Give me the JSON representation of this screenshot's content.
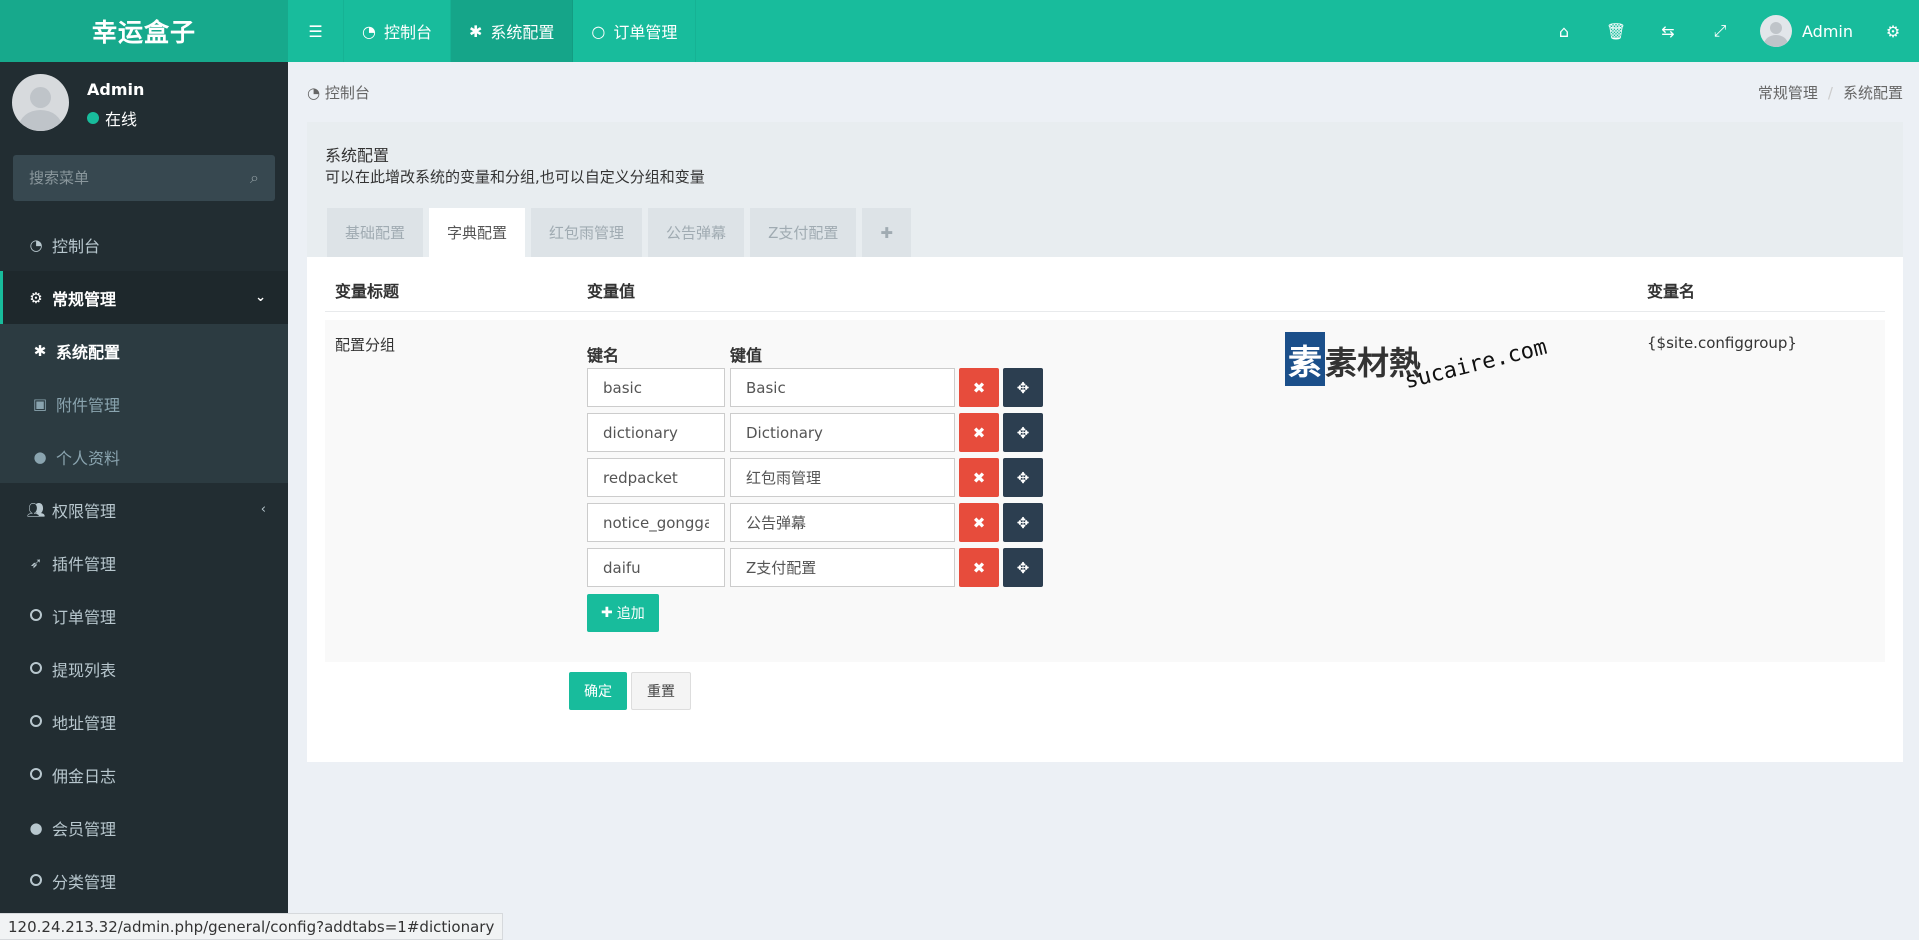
{
  "app": {
    "logo": "幸运盒子"
  },
  "topnav": {
    "toggle_icon": "menu-icon",
    "items": [
      {
        "label": "控制台",
        "icon": "dashboard-icon"
      },
      {
        "label": "系统配置",
        "icon": "gear-icon"
      },
      {
        "label": "订单管理",
        "icon": "circle-icon"
      }
    ],
    "right_icons": [
      "home-icon",
      "trash-icon",
      "translate-icon",
      "fullscreen-icon"
    ],
    "user": "Admin",
    "settings_icon": "cogs-icon"
  },
  "sidebar": {
    "user_name": "Admin",
    "status": "在线",
    "search_placeholder": "搜索菜单",
    "items": [
      {
        "label": "控制台"
      },
      {
        "label": "常规管理"
      },
      {
        "label": "系统配置"
      },
      {
        "label": "附件管理"
      },
      {
        "label": "个人资料"
      },
      {
        "label": "权限管理"
      },
      {
        "label": "插件管理"
      },
      {
        "label": "订单管理"
      },
      {
        "label": "提现列表"
      },
      {
        "label": "地址管理"
      },
      {
        "label": "佣金日志"
      },
      {
        "label": "会员管理"
      },
      {
        "label": "分类管理"
      }
    ]
  },
  "header": {
    "title": "控制台",
    "breadcrumbs": [
      "常规管理",
      "系统配置"
    ]
  },
  "panel": {
    "title": "系统配置",
    "description": "可以在此增改系统的变量和分组,也可以自定义分组和变量",
    "tabs": [
      "基础配置",
      "字典配置",
      "红包雨管理",
      "公告弹幕",
      "Z支付配置",
      "✚"
    ]
  },
  "table": {
    "headers": [
      "变量标题",
      "变量值",
      "变量名"
    ],
    "row_label": "配置分组",
    "key_header": "键名",
    "value_header": "键值",
    "var_name": "{$site.configgroup}",
    "rows": [
      {
        "key": "basic",
        "value": "Basic"
      },
      {
        "key": "dictionary",
        "value": "Dictionary"
      },
      {
        "key": "redpacket",
        "value": "红包雨管理"
      },
      {
        "key": "notice_gonggao",
        "value": "公告弹幕"
      },
      {
        "key": "daifu",
        "value": "Z支付配置"
      }
    ],
    "add_label": "追加"
  },
  "watermark": {
    "cn": "素材熱",
    "box": "素",
    "en": "sucaire.com"
  },
  "buttons": {
    "ok": "确定",
    "reset": "重置"
  },
  "statusbar": "120.24.213.32/admin.php/general/config?addtabs=1#dictionary",
  "colors": {
    "primary": "#18bc9c",
    "sidebar": "#222d32",
    "danger": "#e74c3c",
    "dark": "#2c3e50"
  }
}
